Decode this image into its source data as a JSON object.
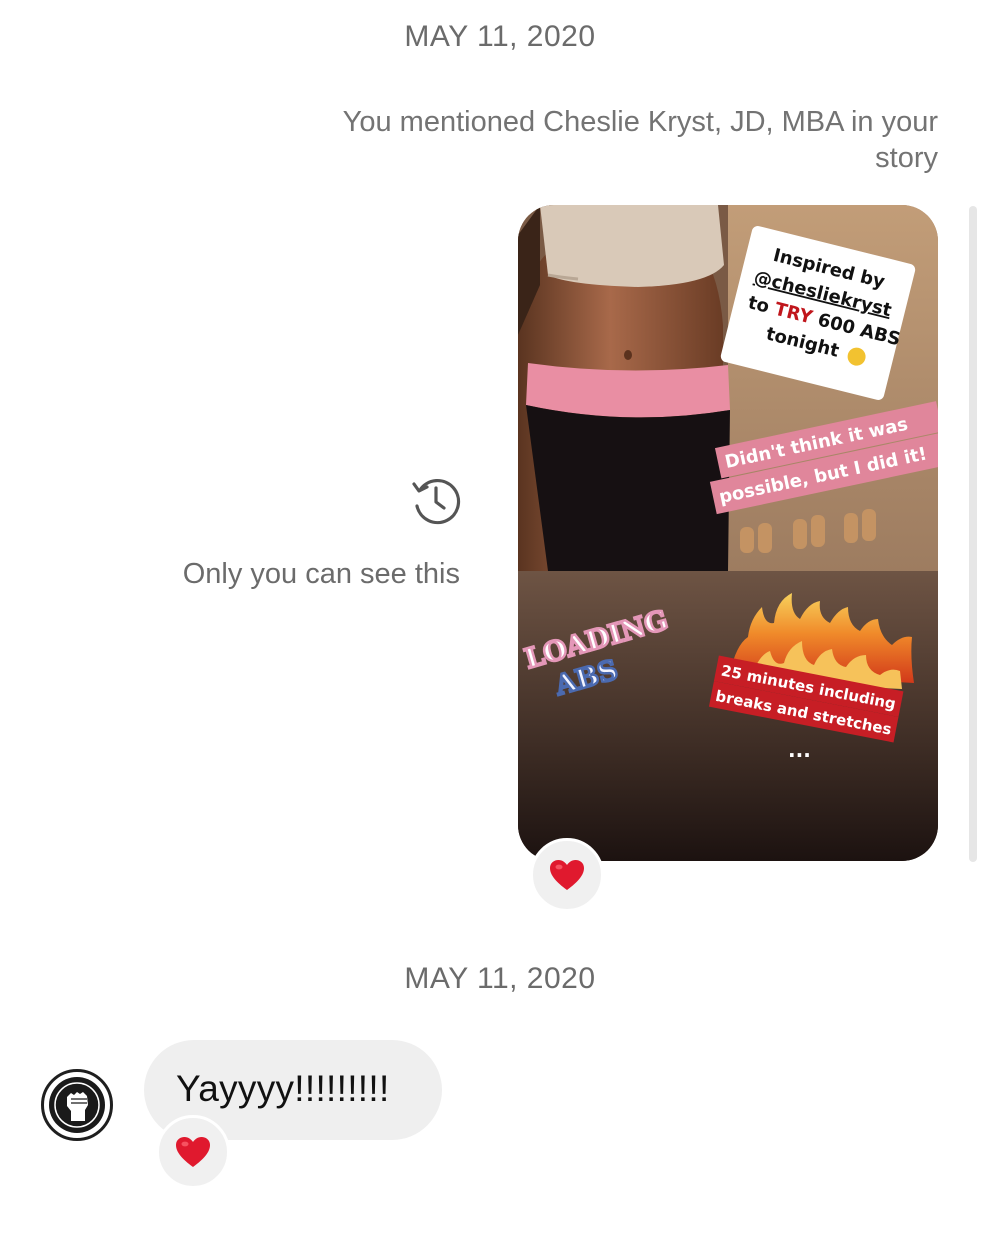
{
  "thread": {
    "first_date": "MAY 11, 2020",
    "mention_text": "You mentioned Cheslie Kryst, JD, MBA in your story",
    "visibility_note": "Only you can see this",
    "second_date": "MAY 11, 2020"
  },
  "story": {
    "inspired_line1": "Inspired by",
    "handle": "@chesliekryst",
    "to_word": "to ",
    "try_word": "TRY",
    "abs_count": " 600 ABS",
    "tonight": "tonight",
    "didnt_line1": "Didn't think it was",
    "didnt_line2": "possible, but I did it!",
    "loading": "LOADING",
    "abs_word": "ABS",
    "minutes_line1": "25 minutes including",
    "minutes_line2": "breaks and stretches",
    "ellipsis": "..."
  },
  "messages": [
    {
      "text": "Yayyyy!!!!!!!!!"
    }
  ],
  "reactions": {
    "story_reaction": "heart-emoji",
    "message_reaction": "heart-emoji",
    "heart_color": "#e0192e"
  },
  "icons": {
    "history": "history-icon",
    "avatar": "raised-fist-avatar"
  }
}
